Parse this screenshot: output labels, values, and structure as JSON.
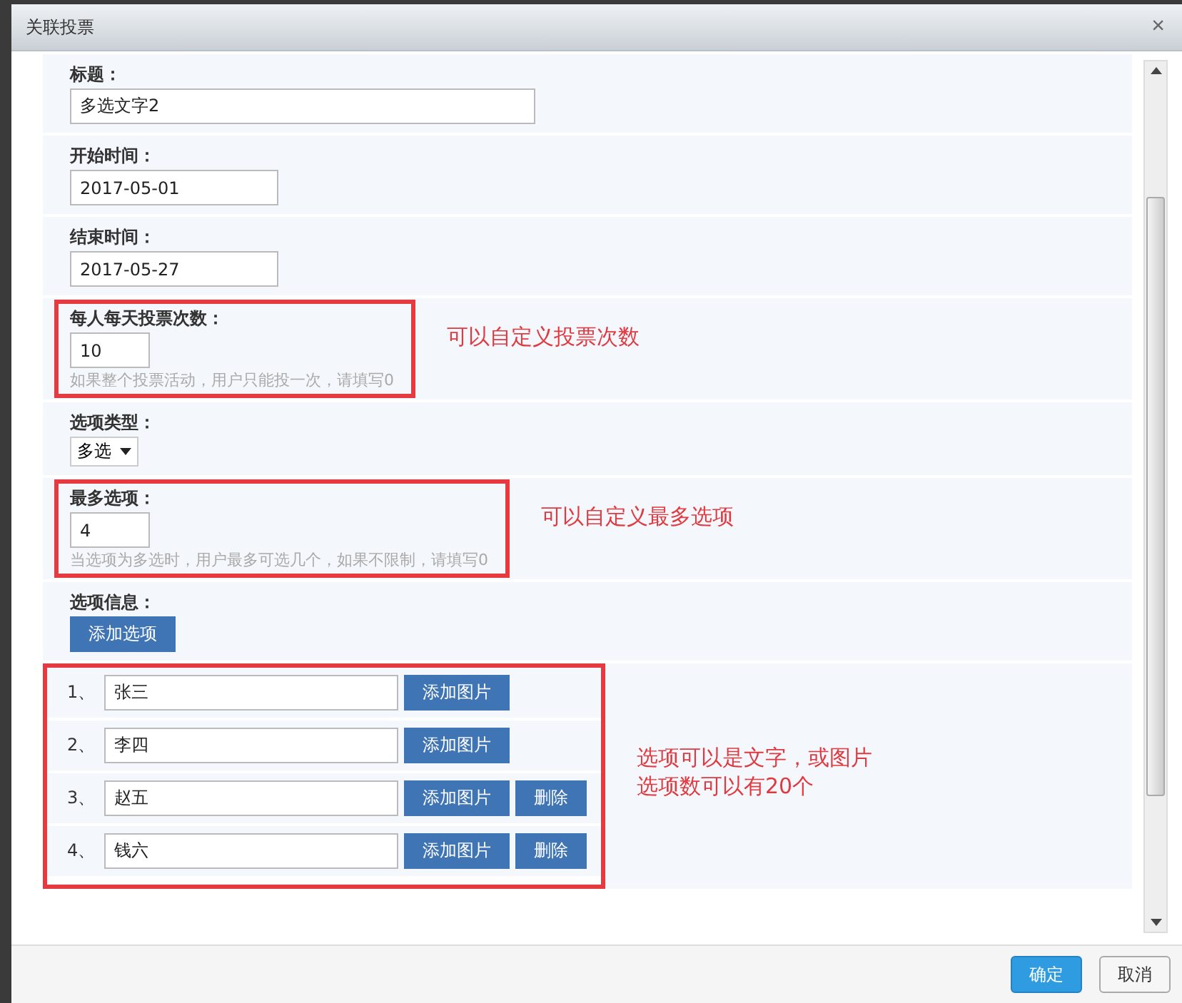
{
  "dialog": {
    "title": "关联投票",
    "close": "×"
  },
  "fields": [
    {
      "kind": "text",
      "label": "标题：",
      "value": "多选文字2"
    },
    {
      "kind": "date",
      "label": "开始时间：",
      "value": "2017-05-01"
    },
    {
      "kind": "date",
      "label": "结束时间：",
      "value": "2017-05-27"
    },
    {
      "kind": "number",
      "label": "每人每天投票次数：",
      "value": "10",
      "hint": "如果整个投票活动，用户只能投一次，请填写0",
      "annotation": "可以自定义投票次数"
    },
    {
      "kind": "select",
      "label": "选项类型：",
      "value": "多选"
    },
    {
      "kind": "number",
      "label": "最多选项：",
      "value": "4",
      "hint": "当选项为多选时，用户最多可选几个，如果不限制，请填写0",
      "annotation": "可以自定义最多选项"
    }
  ],
  "options": {
    "label": "选项信息：",
    "add_button": "添加选项",
    "annotation": [
      "选项可以是文字，或图片",
      "选项数可以有20个"
    ],
    "items": [
      {
        "number": "1、",
        "value": "张三",
        "image_button": "添加图片"
      },
      {
        "number": "2、",
        "value": "李四",
        "image_button": "添加图片"
      },
      {
        "number": "3、",
        "value": "赵五",
        "image_button": "添加图片",
        "delete_button": "删除"
      },
      {
        "number": "4、",
        "value": "钱六",
        "image_button": "添加图片",
        "delete_button": "删除"
      }
    ]
  },
  "footer": [
    {
      "label": "确定",
      "kind": "primary"
    },
    {
      "label": "取消",
      "kind": "default"
    }
  ]
}
